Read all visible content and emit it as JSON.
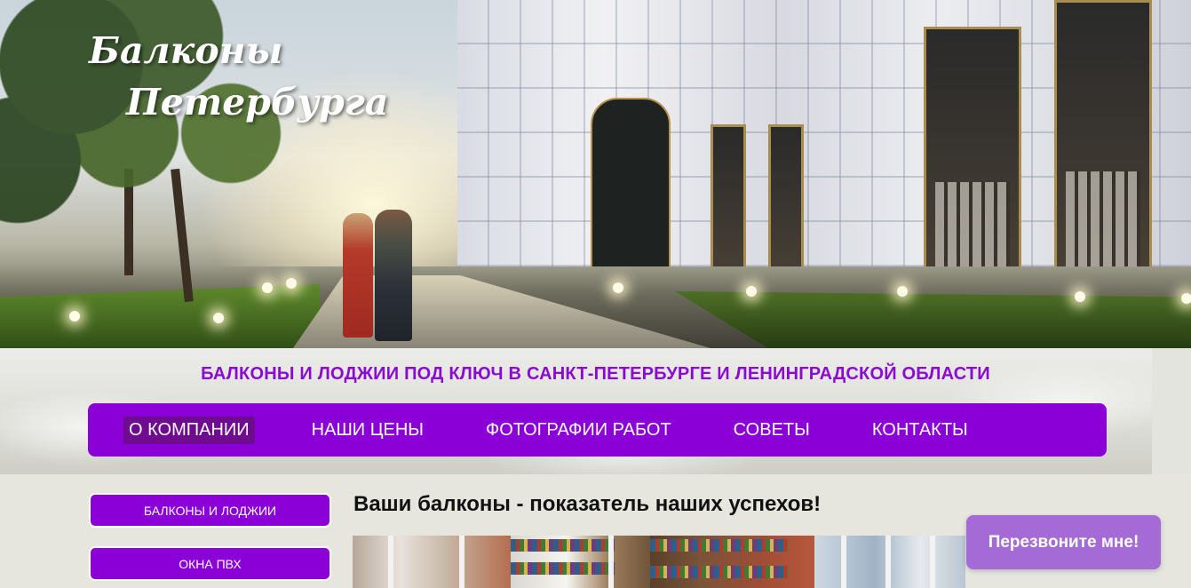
{
  "header": {
    "logo_line1": "Балконы",
    "logo_line2": "Петербурга"
  },
  "tagline": "БАЛКОНЫ И ЛОДЖИИ ПОД КЛЮЧ В САНКТ-ПЕТЕРБУРГЕ И ЛЕНИНГРАДСКОЙ ОБЛАСТИ",
  "nav": {
    "items": [
      {
        "label": "О КОМПАНИИ",
        "active": true
      },
      {
        "label": "НАШИ ЦЕНЫ"
      },
      {
        "label": "ФОТОГРАФИИ РАБОТ"
      },
      {
        "label": "СОВЕТЫ"
      },
      {
        "label": "КОНТАКТЫ"
      }
    ]
  },
  "sidebar": {
    "items": [
      {
        "label": "БАЛКОНЫ И ЛОДЖИИ"
      },
      {
        "label": "ОКНА ПВХ"
      }
    ]
  },
  "main": {
    "heading": "Ваши балконы - показатель наших успехов!"
  },
  "callback_button": "Перезвоните мне!",
  "colors": {
    "accent": "#8b00d6",
    "active_nav": "#6f0b8f",
    "callback": "#a46bd6"
  }
}
